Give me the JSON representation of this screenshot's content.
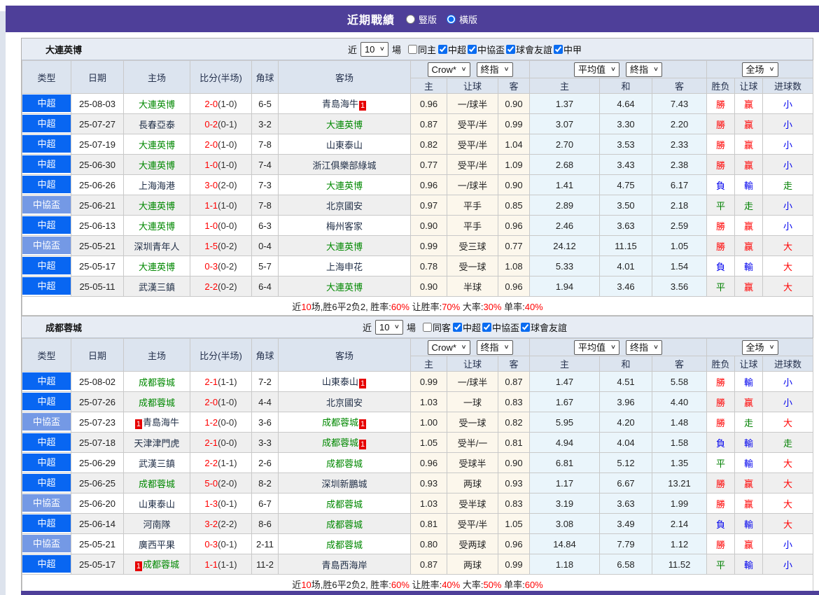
{
  "banner": {
    "title": "近期戰績",
    "vertical_label": "豎版",
    "horizontal_label": "橫版",
    "selected": "橫版"
  },
  "labels": {
    "near": "近",
    "matches": "場"
  },
  "controls": {
    "rounds": "10"
  },
  "header": {
    "columns": {
      "type": "类型",
      "date": "日期",
      "home": "主场",
      "score": "比分(半场)",
      "corner": "角球",
      "away": "客场"
    },
    "sub": [
      "主",
      "让球",
      "客",
      "主",
      "和",
      "客",
      "胜负",
      "让球",
      "进球数"
    ]
  },
  "colors": {
    "banner_purple": "#4e3f99",
    "league_csl_blue": "#0866f2",
    "league_cup_blue": "#7499e5",
    "focus_team_green": "#008800",
    "win_red": "#ff0000",
    "lose_blue": "#0000ee",
    "draw_green": "#008000",
    "odds_bg": "#fcf7ec",
    "avg_bg": "#eaf5fb",
    "header_bg": "#dce4ef",
    "alt_row": "#efefef"
  },
  "teams": [
    {
      "name": "大連英博",
      "filter": {
        "same_label": "同主",
        "same_checked": false,
        "leagues": [
          "中超",
          "中協盃",
          "球會友誼",
          "中甲"
        ]
      },
      "selects": {
        "odds1": "Crow*",
        "odds2": "終指",
        "avg1": "平均值",
        "avg2": "終指",
        "full": "全场"
      },
      "rows": [
        {
          "lg": "中超",
          "cup": false,
          "date": "25-08-03",
          "home": "大連英博",
          "homeFocus": true,
          "homeBadge": null,
          "score": "2-0",
          "half": "(1-0)",
          "corner": "6-5",
          "away": "青島海牛",
          "awayFocus": false,
          "awayBadge": "post",
          "o1": "0.96",
          "hc": "一/球半",
          "o2": "0.90",
          "a1": "1.37",
          "a2": "4.64",
          "a3": "7.43",
          "res": [
            [
              "勝",
              "r"
            ],
            [
              "赢",
              "r"
            ],
            [
              "小",
              "b"
            ]
          ]
        },
        {
          "lg": "中超",
          "cup": false,
          "date": "25-07-27",
          "home": "長春亞泰",
          "homeFocus": false,
          "homeBadge": null,
          "score": "0-2",
          "half": "(0-1)",
          "corner": "3-2",
          "away": "大連英博",
          "awayFocus": true,
          "awayBadge": null,
          "o1": "0.87",
          "hc": "受平/半",
          "o2": "0.99",
          "a1": "3.07",
          "a2": "3.30",
          "a3": "2.20",
          "res": [
            [
              "勝",
              "r"
            ],
            [
              "赢",
              "r"
            ],
            [
              "小",
              "b"
            ]
          ]
        },
        {
          "lg": "中超",
          "cup": false,
          "date": "25-07-19",
          "home": "大連英博",
          "homeFocus": true,
          "homeBadge": null,
          "score": "2-0",
          "half": "(1-0)",
          "corner": "7-8",
          "away": "山東泰山",
          "awayFocus": false,
          "awayBadge": null,
          "o1": "0.82",
          "hc": "受平/半",
          "o2": "1.04",
          "a1": "2.70",
          "a2": "3.53",
          "a3": "2.33",
          "res": [
            [
              "勝",
              "r"
            ],
            [
              "赢",
              "r"
            ],
            [
              "小",
              "b"
            ]
          ]
        },
        {
          "lg": "中超",
          "cup": false,
          "date": "25-06-30",
          "home": "大連英博",
          "homeFocus": true,
          "homeBadge": null,
          "score": "1-0",
          "half": "(1-0)",
          "corner": "7-4",
          "away": "浙江俱樂部綠城",
          "awayFocus": false,
          "awayBadge": null,
          "o1": "0.77",
          "hc": "受平/半",
          "o2": "1.09",
          "a1": "2.68",
          "a2": "3.43",
          "a3": "2.38",
          "res": [
            [
              "勝",
              "r"
            ],
            [
              "赢",
              "r"
            ],
            [
              "小",
              "b"
            ]
          ]
        },
        {
          "lg": "中超",
          "cup": false,
          "date": "25-06-26",
          "home": "上海海港",
          "homeFocus": false,
          "homeBadge": null,
          "score": "3-0",
          "half": "(2-0)",
          "corner": "7-3",
          "away": "大連英博",
          "awayFocus": true,
          "awayBadge": null,
          "o1": "0.96",
          "hc": "一/球半",
          "o2": "0.90",
          "a1": "1.41",
          "a2": "4.75",
          "a3": "6.17",
          "res": [
            [
              "負",
              "bl"
            ],
            [
              "輸",
              "bl"
            ],
            [
              "走",
              "g"
            ]
          ]
        },
        {
          "lg": "中協盃",
          "cup": true,
          "date": "25-06-21",
          "home": "大連英博",
          "homeFocus": true,
          "homeBadge": null,
          "score": "1-1",
          "half": "(1-0)",
          "corner": "7-8",
          "away": "北京國安",
          "awayFocus": false,
          "awayBadge": null,
          "o1": "0.97",
          "hc": "平手",
          "o2": "0.85",
          "a1": "2.89",
          "a2": "3.50",
          "a3": "2.18",
          "res": [
            [
              "平",
              "g"
            ],
            [
              "走",
              "g"
            ],
            [
              "小",
              "b"
            ]
          ]
        },
        {
          "lg": "中超",
          "cup": false,
          "date": "25-06-13",
          "home": "大連英博",
          "homeFocus": true,
          "homeBadge": null,
          "score": "1-0",
          "half": "(0-0)",
          "corner": "6-3",
          "away": "梅州客家",
          "awayFocus": false,
          "awayBadge": null,
          "o1": "0.90",
          "hc": "平手",
          "o2": "0.96",
          "a1": "2.46",
          "a2": "3.63",
          "a3": "2.59",
          "res": [
            [
              "勝",
              "r"
            ],
            [
              "赢",
              "r"
            ],
            [
              "小",
              "b"
            ]
          ]
        },
        {
          "lg": "中協盃",
          "cup": true,
          "date": "25-05-21",
          "home": "深圳青年人",
          "homeFocus": false,
          "homeBadge": null,
          "score": "1-5",
          "half": "(0-2)",
          "corner": "0-4",
          "away": "大連英博",
          "awayFocus": true,
          "awayBadge": null,
          "o1": "0.99",
          "hc": "受三球",
          "o2": "0.77",
          "a1": "24.12",
          "a2": "11.15",
          "a3": "1.05",
          "res": [
            [
              "勝",
              "r"
            ],
            [
              "赢",
              "r"
            ],
            [
              "大",
              "rd"
            ]
          ]
        },
        {
          "lg": "中超",
          "cup": false,
          "date": "25-05-17",
          "home": "大連英博",
          "homeFocus": true,
          "homeBadge": null,
          "score": "0-3",
          "half": "(0-2)",
          "corner": "5-7",
          "away": "上海申花",
          "awayFocus": false,
          "awayBadge": null,
          "o1": "0.78",
          "hc": "受一球",
          "o2": "1.08",
          "a1": "5.33",
          "a2": "4.01",
          "a3": "1.54",
          "res": [
            [
              "負",
              "bl"
            ],
            [
              "輸",
              "bl"
            ],
            [
              "大",
              "rd"
            ]
          ]
        },
        {
          "lg": "中超",
          "cup": false,
          "date": "25-05-11",
          "home": "武漢三鎮",
          "homeFocus": false,
          "homeBadge": null,
          "score": "2-2",
          "half": "(0-2)",
          "corner": "6-4",
          "away": "大連英博",
          "awayFocus": true,
          "awayBadge": null,
          "o1": "0.90",
          "hc": "半球",
          "o2": "0.96",
          "a1": "1.94",
          "a2": "3.46",
          "a3": "3.56",
          "res": [
            [
              "平",
              "g"
            ],
            [
              "赢",
              "r"
            ],
            [
              "大",
              "rd"
            ]
          ]
        }
      ],
      "summary": [
        {
          "t": "近",
          "red": false
        },
        {
          "t": "10",
          "red": true
        },
        {
          "t": "场,胜6平2负2, 胜率:",
          "red": false
        },
        {
          "t": "60%",
          "red": true
        },
        {
          "t": " 让胜率:",
          "red": false
        },
        {
          "t": "70%",
          "red": true
        },
        {
          "t": " 大率:",
          "red": false
        },
        {
          "t": "30%",
          "red": true
        },
        {
          "t": " 单率:",
          "red": false
        },
        {
          "t": "40%",
          "red": true
        }
      ]
    },
    {
      "name": "成都蓉城",
      "filter": {
        "same_label": "同客",
        "same_checked": false,
        "leagues": [
          "中超",
          "中協盃",
          "球會友誼"
        ]
      },
      "selects": {
        "odds1": "Crow*",
        "odds2": "终指",
        "avg1": "平均值",
        "avg2": "终指",
        "full": "全场"
      },
      "rows": [
        {
          "lg": "中超",
          "cup": false,
          "date": "25-08-02",
          "home": "成都蓉城",
          "homeFocus": true,
          "homeBadge": null,
          "score": "2-1",
          "half": "(1-1)",
          "corner": "7-2",
          "away": "山東泰山",
          "awayFocus": false,
          "awayBadge": "post",
          "o1": "0.99",
          "hc": "一/球半",
          "o2": "0.87",
          "a1": "1.47",
          "a2": "4.51",
          "a3": "5.58",
          "res": [
            [
              "勝",
              "r"
            ],
            [
              "輸",
              "bl"
            ],
            [
              "小",
              "b"
            ]
          ]
        },
        {
          "lg": "中超",
          "cup": false,
          "date": "25-07-26",
          "home": "成都蓉城",
          "homeFocus": true,
          "homeBadge": null,
          "score": "2-0",
          "half": "(1-0)",
          "corner": "4-4",
          "away": "北京國安",
          "awayFocus": false,
          "awayBadge": null,
          "o1": "1.03",
          "hc": "一球",
          "o2": "0.83",
          "a1": "1.67",
          "a2": "3.96",
          "a3": "4.40",
          "res": [
            [
              "勝",
              "r"
            ],
            [
              "赢",
              "r"
            ],
            [
              "小",
              "b"
            ]
          ]
        },
        {
          "lg": "中協盃",
          "cup": true,
          "date": "25-07-23",
          "home": "青島海牛",
          "homeFocus": false,
          "homeBadge": "pre",
          "score": "1-2",
          "half": "(0-0)",
          "corner": "3-6",
          "away": "成都蓉城",
          "awayFocus": true,
          "awayBadge": "post",
          "o1": "1.00",
          "hc": "受一球",
          "o2": "0.82",
          "a1": "5.95",
          "a2": "4.20",
          "a3": "1.48",
          "res": [
            [
              "勝",
              "r"
            ],
            [
              "走",
              "g"
            ],
            [
              "大",
              "rd"
            ]
          ]
        },
        {
          "lg": "中超",
          "cup": false,
          "date": "25-07-18",
          "home": "天津津門虎",
          "homeFocus": false,
          "homeBadge": null,
          "score": "2-1",
          "half": "(0-0)",
          "corner": "3-3",
          "away": "成都蓉城",
          "awayFocus": true,
          "awayBadge": "post",
          "o1": "1.05",
          "hc": "受半/一",
          "o2": "0.81",
          "a1": "4.94",
          "a2": "4.04",
          "a3": "1.58",
          "res": [
            [
              "負",
              "bl"
            ],
            [
              "輸",
              "bl"
            ],
            [
              "走",
              "g"
            ]
          ]
        },
        {
          "lg": "中超",
          "cup": false,
          "date": "25-06-29",
          "home": "武漢三鎮",
          "homeFocus": false,
          "homeBadge": null,
          "score": "2-2",
          "half": "(1-1)",
          "corner": "2-6",
          "away": "成都蓉城",
          "awayFocus": true,
          "awayBadge": null,
          "o1": "0.96",
          "hc": "受球半",
          "o2": "0.90",
          "a1": "6.81",
          "a2": "5.12",
          "a3": "1.35",
          "res": [
            [
              "平",
              "g"
            ],
            [
              "輸",
              "bl"
            ],
            [
              "大",
              "rd"
            ]
          ]
        },
        {
          "lg": "中超",
          "cup": false,
          "date": "25-06-25",
          "home": "成都蓉城",
          "homeFocus": true,
          "homeBadge": null,
          "score": "5-0",
          "half": "(2-0)",
          "corner": "8-2",
          "away": "深圳新鵬城",
          "awayFocus": false,
          "awayBadge": null,
          "o1": "0.93",
          "hc": "两球",
          "o2": "0.93",
          "a1": "1.17",
          "a2": "6.67",
          "a3": "13.21",
          "res": [
            [
              "勝",
              "r"
            ],
            [
              "赢",
              "r"
            ],
            [
              "大",
              "rd"
            ]
          ]
        },
        {
          "lg": "中協盃",
          "cup": true,
          "date": "25-06-20",
          "home": "山東泰山",
          "homeFocus": false,
          "homeBadge": null,
          "score": "1-3",
          "half": "(0-1)",
          "corner": "6-7",
          "away": "成都蓉城",
          "awayFocus": true,
          "awayBadge": null,
          "o1": "1.03",
          "hc": "受半球",
          "o2": "0.83",
          "a1": "3.19",
          "a2": "3.63",
          "a3": "1.99",
          "res": [
            [
              "勝",
              "r"
            ],
            [
              "赢",
              "r"
            ],
            [
              "大",
              "rd"
            ]
          ]
        },
        {
          "lg": "中超",
          "cup": false,
          "date": "25-06-14",
          "home": "河南隊",
          "homeFocus": false,
          "homeBadge": null,
          "score": "3-2",
          "half": "(2-2)",
          "corner": "8-6",
          "away": "成都蓉城",
          "awayFocus": true,
          "awayBadge": null,
          "o1": "0.81",
          "hc": "受平/半",
          "o2": "1.05",
          "a1": "3.08",
          "a2": "3.49",
          "a3": "2.14",
          "res": [
            [
              "負",
              "bl"
            ],
            [
              "輸",
              "bl"
            ],
            [
              "大",
              "rd"
            ]
          ]
        },
        {
          "lg": "中協盃",
          "cup": true,
          "date": "25-05-21",
          "home": "廣西平果",
          "homeFocus": false,
          "homeBadge": null,
          "score": "0-3",
          "half": "(0-1)",
          "corner": "2-11",
          "away": "成都蓉城",
          "awayFocus": true,
          "awayBadge": null,
          "o1": "0.80",
          "hc": "受两球",
          "o2": "0.96",
          "a1": "14.84",
          "a2": "7.79",
          "a3": "1.12",
          "res": [
            [
              "勝",
              "r"
            ],
            [
              "赢",
              "r"
            ],
            [
              "小",
              "b"
            ]
          ]
        },
        {
          "lg": "中超",
          "cup": false,
          "date": "25-05-17",
          "home": "成都蓉城",
          "homeFocus": true,
          "homeBadge": "pre",
          "score": "1-1",
          "half": "(1-1)",
          "corner": "11-2",
          "away": "青島西海岸",
          "awayFocus": false,
          "awayBadge": null,
          "o1": "0.87",
          "hc": "两球",
          "o2": "0.99",
          "a1": "1.18",
          "a2": "6.58",
          "a3": "11.52",
          "res": [
            [
              "平",
              "g"
            ],
            [
              "輸",
              "bl"
            ],
            [
              "小",
              "b"
            ]
          ]
        }
      ],
      "summary": [
        {
          "t": "近",
          "red": false
        },
        {
          "t": "10",
          "red": true
        },
        {
          "t": "场,胜6平2负2, 胜率:",
          "red": false
        },
        {
          "t": "60%",
          "red": true
        },
        {
          "t": " 让胜率:",
          "red": false
        },
        {
          "t": "40%",
          "red": true
        },
        {
          "t": " 大率:",
          "red": false
        },
        {
          "t": "50%",
          "red": true
        },
        {
          "t": " 单率:",
          "red": false
        },
        {
          "t": "60%",
          "red": true
        }
      ]
    }
  ]
}
